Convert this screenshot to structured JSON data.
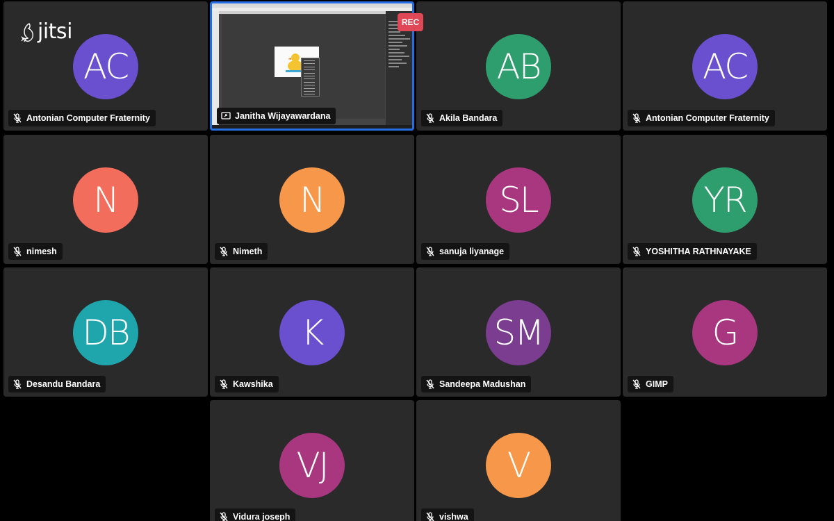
{
  "app": {
    "logo_text": "jitsi"
  },
  "recording": {
    "label": "REC",
    "color": "#e04757"
  },
  "participants": [
    {
      "initials": "AC",
      "name": "Antonian Computer Fraternity",
      "color": "#6a4fcf",
      "muted": true
    },
    {
      "initials": "",
      "name": "Janitha Wijayawardana",
      "color": "",
      "muted": false,
      "screenshare": true,
      "active": true
    },
    {
      "initials": "AB",
      "name": "Akila Bandara",
      "color": "#2f9e6e",
      "muted": true
    },
    {
      "initials": "AC",
      "name": "Antonian Computer Fraternity",
      "color": "#6a4fcf",
      "muted": true
    },
    {
      "initials": "N",
      "name": "nimesh",
      "color": "#f26d5b",
      "muted": true
    },
    {
      "initials": "N",
      "name": "Nimeth",
      "color": "#f7974a",
      "muted": true
    },
    {
      "initials": "SL",
      "name": "sanuja liyanage",
      "color": "#a8377f",
      "muted": true
    },
    {
      "initials": "YR",
      "name": "YOSHITHA RATHNAYAKE",
      "color": "#2f9e6e",
      "muted": true
    },
    {
      "initials": "DB",
      "name": "Desandu Bandara",
      "color": "#1fa6ad",
      "muted": true
    },
    {
      "initials": "K",
      "name": "Kawshika",
      "color": "#6a4fcf",
      "muted": true
    },
    {
      "initials": "SM",
      "name": "Sandeepa Madushan",
      "color": "#7a3d8f",
      "muted": true
    },
    {
      "initials": "G",
      "name": "GIMP",
      "color": "#a8377f",
      "muted": true
    },
    {
      "initials": "VJ",
      "name": "Vidura joseph",
      "color": "#a8377f",
      "muted": true
    },
    {
      "initials": "V",
      "name": "vishwa",
      "color": "#f7974a",
      "muted": true
    }
  ],
  "colors": {
    "tile_bg": "#2a2a2a",
    "active_border": "#246fe5",
    "page_bg": "#000000"
  }
}
